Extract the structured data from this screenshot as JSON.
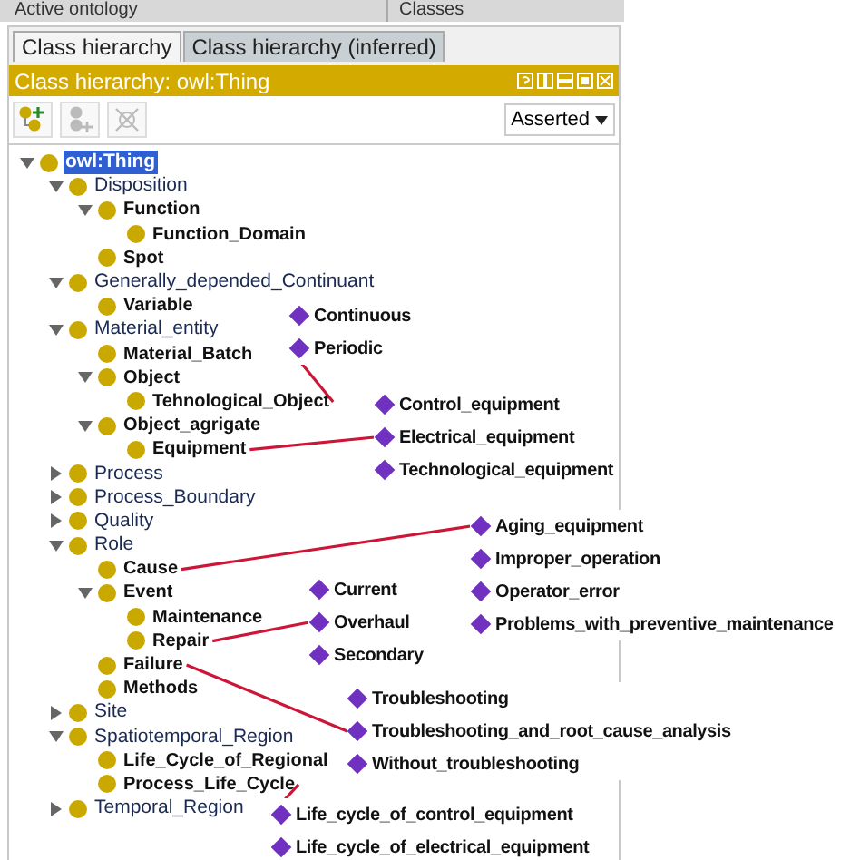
{
  "top_bar": {
    "left_title": "Active ontology",
    "right_title": "Classes"
  },
  "tabs": [
    {
      "label": "Class hierarchy",
      "selected": true
    },
    {
      "label": "Class hierarchy (inferred)",
      "selected": false
    }
  ],
  "view_title": "Class hierarchy: owl:Thing",
  "mode_dropdown": {
    "value": "Asserted"
  },
  "tree": [
    {
      "label": "owl:Thing",
      "selected": true,
      "expanded": true,
      "children": [
        {
          "label": "Disposition",
          "selected": false,
          "expanded": true,
          "children": [
            {
              "label": "Function",
              "selected": false,
              "expanded": true,
              "children": [
                {
                  "label": "Function_Domain",
                  "selected": false
                }
              ]
            },
            {
              "label": "Spot",
              "selected": false
            }
          ]
        },
        {
          "label": "Generally_depended_Continuant",
          "selected": false,
          "expanded": true,
          "children": [
            {
              "label": "Variable",
              "selected": false
            }
          ]
        },
        {
          "label": "Material_entity",
          "selected": false,
          "expanded": true,
          "children": [
            {
              "label": "Material_Batch",
              "selected": false
            },
            {
              "label": "Object",
              "selected": false,
              "expanded": true,
              "children": [
                {
                  "label": "Tehnological_Object",
                  "selected": false,
                  "individuals": [
                    "Continuous",
                    "Periodic"
                  ]
                }
              ]
            },
            {
              "label": "Object_agrigate",
              "selected": false,
              "expanded": true,
              "children": [
                {
                  "label": "Equipment",
                  "selected": false,
                  "individuals": [
                    "Control_equipment",
                    "Electrical_equipment",
                    "Technological_equipment"
                  ]
                }
              ]
            }
          ]
        },
        {
          "label": "Process",
          "selected": false,
          "expanded": false
        },
        {
          "label": "Process_Boundary",
          "selected": false,
          "expanded": false
        },
        {
          "label": "Quality",
          "selected": false,
          "expanded": false
        },
        {
          "label": "Role",
          "selected": false,
          "expanded": true,
          "children": [
            {
              "label": "Cause",
              "selected": false,
              "individuals": [
                "Aging_equipment",
                "Improper_operation",
                "Operator_error",
                "Problems_with_preventive_maintenance"
              ]
            },
            {
              "label": "Event",
              "selected": false,
              "expanded": true,
              "children": [
                {
                  "label": "Maintenance",
                  "selected": false
                },
                {
                  "label": "Repair",
                  "selected": false,
                  "individuals": [
                    "Current",
                    "Overhaul",
                    "Secondary"
                  ]
                }
              ]
            },
            {
              "label": "Failure",
              "selected": false,
              "individuals": [
                "Troubleshooting",
                "Troubleshooting_and_root_cause_analysis",
                "Without_troubleshooting"
              ]
            },
            {
              "label": "Methods",
              "selected": false
            }
          ]
        },
        {
          "label": "Site",
          "selected": false,
          "expanded": false
        },
        {
          "label": "Spatiotemporal_Region",
          "selected": false,
          "expanded": true,
          "children": [
            {
              "label": "Life_Cycle_of_Regional",
              "selected": false
            },
            {
              "label": "Process_Life_Cycle",
              "selected": false,
              "individuals": [
                "Life_cycle_of_control_equipment",
                "Life_cycle_of_electrical_equipment"
              ]
            }
          ]
        },
        {
          "label": "Temporal_Region",
          "selected": false,
          "expanded": false
        }
      ]
    }
  ]
}
